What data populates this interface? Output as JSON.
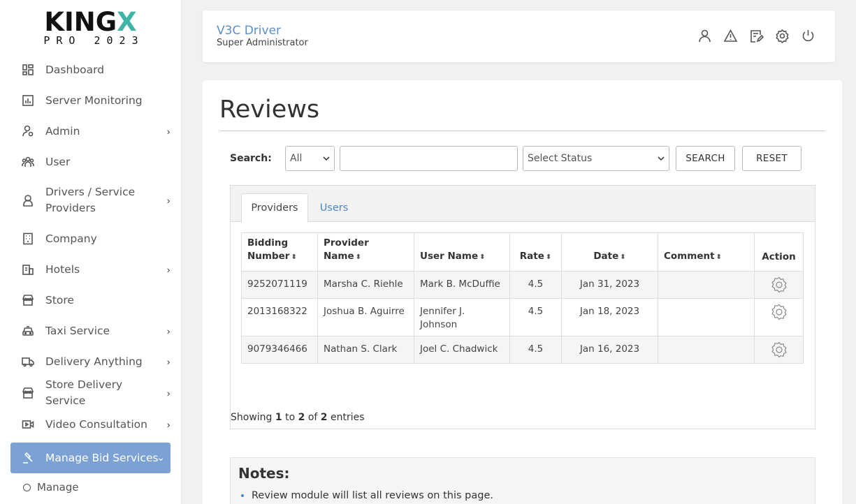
{
  "logo": {
    "brand_main": "KING",
    "brand_x": "X",
    "sub": "PRO 2023"
  },
  "sidebar": {
    "items": [
      {
        "label": "Dashboard",
        "icon": "dashboard-icon",
        "chevron": false
      },
      {
        "label": "Server Monitoring",
        "icon": "chart-icon",
        "chevron": false
      },
      {
        "label": "Admin",
        "icon": "admin-user-icon",
        "chevron": true
      },
      {
        "label": "User",
        "icon": "users-icon",
        "chevron": false
      },
      {
        "label": "Drivers / Service Providers",
        "icon": "driver-icon",
        "chevron": true
      },
      {
        "label": "Company",
        "icon": "building-icon",
        "chevron": false
      },
      {
        "label": "Hotels",
        "icon": "hotel-icon",
        "chevron": true
      },
      {
        "label": "Store",
        "icon": "store-icon",
        "chevron": false
      },
      {
        "label": "Taxi Service",
        "icon": "taxi-icon",
        "chevron": true
      },
      {
        "label": "Delivery Anything",
        "icon": "truck-icon",
        "chevron": true
      },
      {
        "label": "Store Delivery Service",
        "icon": "store-icon",
        "chevron": true
      },
      {
        "label": "Video Consultation",
        "icon": "video-icon",
        "chevron": true
      },
      {
        "label": "Manage Bid Services",
        "icon": "gavel-icon",
        "chevron": true
      }
    ],
    "sub_items": [
      {
        "label": "Manage"
      }
    ],
    "chevron_right": "›",
    "chevron_down": "⌄"
  },
  "header": {
    "name": "V3C Driver",
    "role": "Super Administrator",
    "icons": [
      "profile-icon",
      "alert-icon",
      "edit-icon",
      "settings-icon",
      "power-icon"
    ]
  },
  "page": {
    "title": "Reviews"
  },
  "search": {
    "label": "Search:",
    "filter_value": "All",
    "input_value": "",
    "status_value": "Select Status",
    "search_button": "SEARCH",
    "reset_button": "RESET"
  },
  "tabs": [
    {
      "label": "Providers",
      "active": true
    },
    {
      "label": "Users",
      "active": false
    }
  ],
  "table": {
    "headers": [
      "Bidding Number",
      "Provider Name",
      "User Name",
      "Rate",
      "Date",
      "Comment",
      "Action"
    ],
    "sort_icon": "⬍",
    "rows": [
      {
        "bidding_number": "9252071119",
        "provider": "Marsha C. Riehle",
        "user": "Mark B. McDuffie",
        "rate": "4.5",
        "date": "Jan 31, 2023",
        "comment": ""
      },
      {
        "bidding_number": "2013168322",
        "provider": "Joshua B. Aguirre",
        "user": "Jennifer J. Johnson",
        "rate": "4.5",
        "date": "Jan 18, 2023",
        "comment": ""
      },
      {
        "bidding_number": "9079346466",
        "provider": "Nathan S. Clark",
        "user": "Joel C. Chadwick",
        "rate": "4.5",
        "date": "Jan 16, 2023",
        "comment": ""
      }
    ]
  },
  "showing": {
    "prefix": "Showing",
    "from": "1",
    "to_word": "to",
    "to": "2",
    "of_word": "of",
    "total": "2",
    "suffix": "entries"
  },
  "notes": {
    "title": "Notes:",
    "items": [
      "Review module will list all reviews on this page."
    ]
  },
  "colors": {
    "accent": "#7ca1d5",
    "link": "#4a86c6",
    "brand_x": "#3fb4a6",
    "header_name": "#5d8ec8"
  }
}
